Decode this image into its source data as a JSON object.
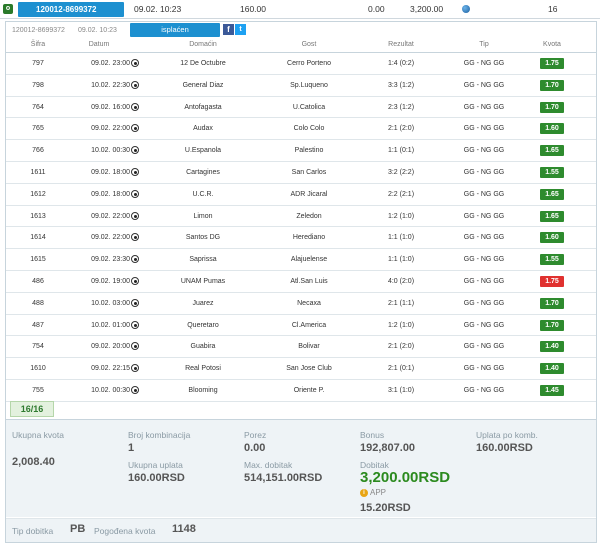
{
  "topbar": {
    "status_letter": "o",
    "ticket_id": "120012-8699372",
    "datetime": "09.02. 10:23",
    "stake": "160.00",
    "zero": "0.00",
    "payout": "3,200.00",
    "count": "16"
  },
  "subhead": {
    "ticket_id": "120012-8699372",
    "datetime": "09.02. 10:23",
    "status_label": "isplaćen",
    "fb": "f",
    "tw": "t"
  },
  "headers": {
    "sifra": "Šifra",
    "datum": "Datum",
    "domacin": "Domaćin",
    "gost": "Gost",
    "rezultat": "Rezultat",
    "tip": "Tip",
    "kvota": "Kvota"
  },
  "rows": [
    {
      "sifra": "797",
      "datum": "09.02. 23:00",
      "home": "12 De Octubre",
      "away": "Cerro Porteno",
      "rez": "1:4 (0:2)",
      "tip": "GG - NG GG",
      "kvota": "1.75",
      "status": "win"
    },
    {
      "sifra": "798",
      "datum": "10.02. 22:30",
      "home": "General Diaz",
      "away": "Sp.Luqueno",
      "rez": "3:3 (1:2)",
      "tip": "GG - NG GG",
      "kvota": "1.70",
      "status": "win"
    },
    {
      "sifra": "764",
      "datum": "09.02. 16:00",
      "home": "Antofagasta",
      "away": "U.Catolica",
      "rez": "2:3 (1:2)",
      "tip": "GG - NG GG",
      "kvota": "1.70",
      "status": "win"
    },
    {
      "sifra": "765",
      "datum": "09.02. 22:00",
      "home": "Audax",
      "away": "Colo Colo",
      "rez": "2:1 (2:0)",
      "tip": "GG - NG GG",
      "kvota": "1.60",
      "status": "win"
    },
    {
      "sifra": "766",
      "datum": "10.02. 00:30",
      "home": "U.Espanola",
      "away": "Palestino",
      "rez": "1:1 (0:1)",
      "tip": "GG - NG GG",
      "kvota": "1.65",
      "status": "win"
    },
    {
      "sifra": "1611",
      "datum": "09.02. 18:00",
      "home": "Cartagines",
      "away": "San Carlos",
      "rez": "3:2 (2:2)",
      "tip": "GG - NG GG",
      "kvota": "1.55",
      "status": "win"
    },
    {
      "sifra": "1612",
      "datum": "09.02. 18:00",
      "home": "U.C.R.",
      "away": "ADR Jicaral",
      "rez": "2:2 (2:1)",
      "tip": "GG - NG GG",
      "kvota": "1.65",
      "status": "win"
    },
    {
      "sifra": "1613",
      "datum": "09.02. 22:00",
      "home": "Limon",
      "away": "Zeledon",
      "rez": "1:2 (1:0)",
      "tip": "GG - NG GG",
      "kvota": "1.65",
      "status": "win"
    },
    {
      "sifra": "1614",
      "datum": "09.02. 22:00",
      "home": "Santos DG",
      "away": "Herediano",
      "rez": "1:1 (1:0)",
      "tip": "GG - NG GG",
      "kvota": "1.60",
      "status": "win"
    },
    {
      "sifra": "1615",
      "datum": "09.02. 23:30",
      "home": "Saprissa",
      "away": "Alajuelense",
      "rez": "1:1 (1:0)",
      "tip": "GG - NG GG",
      "kvota": "1.55",
      "status": "win"
    },
    {
      "sifra": "486",
      "datum": "09.02. 19:00",
      "home": "UNAM Pumas",
      "away": "Atl.San Luis",
      "rez": "4:0 (2:0)",
      "tip": "GG - NG GG",
      "kvota": "1.75",
      "status": "lose"
    },
    {
      "sifra": "488",
      "datum": "10.02. 03:00",
      "home": "Juarez",
      "away": "Necaxa",
      "rez": "2:1 (1:1)",
      "tip": "GG - NG GG",
      "kvota": "1.70",
      "status": "win"
    },
    {
      "sifra": "487",
      "datum": "10.02. 01:00",
      "home": "Queretaro",
      "away": "Cl.America",
      "rez": "1:2 (1:0)",
      "tip": "GG - NG GG",
      "kvota": "1.70",
      "status": "win"
    },
    {
      "sifra": "754",
      "datum": "09.02. 20:00",
      "home": "Guabira",
      "away": "Bolivar",
      "rez": "2:1 (2:0)",
      "tip": "GG - NG GG",
      "kvota": "1.40",
      "status": "win"
    },
    {
      "sifra": "1610",
      "datum": "09.02. 22:15",
      "home": "Real Potosi",
      "away": "San Jose Club",
      "rez": "2:1 (0:1)",
      "tip": "GG - NG GG",
      "kvota": "1.40",
      "status": "win"
    },
    {
      "sifra": "755",
      "datum": "10.02. 00:30",
      "home": "Blooming",
      "away": "Oriente P.",
      "rez": "3:1 (1:0)",
      "tip": "GG - NG GG",
      "kvota": "1.45",
      "status": "win"
    }
  ],
  "count_badge": "16/16",
  "summary": {
    "ukupna_kvota_label": "Ukupna kvota",
    "ukupna_kvota": "2,008.40",
    "broj_kombinacija_label": "Broj kombinacija",
    "broj_kombinacija": "1",
    "ukupna_uplata_label": "Ukupna uplata",
    "ukupna_uplata": "160.00RSD",
    "porez_label": "Porez",
    "porez": "0.00",
    "max_dobitak_label": "Max. dobitak",
    "max_dobitak": "514,151.00RSD",
    "bonus_label": "Bonus",
    "bonus": "192,807.00",
    "dobitak_label": "Dobitak",
    "dobitak": "3,200.00RSD",
    "app_label": "APP",
    "app_value": "15.20RSD",
    "uplata_po_komb_label": "Uplata po komb.",
    "uplata_po_komb": "160.00RSD"
  },
  "footer": {
    "tip_dobitka_label": "Tip dobitka",
    "tip_dobitka": "PB",
    "pogodjena_kvota_label": "Pogođena kvota",
    "pogodjena_kvota": "1148"
  },
  "colors": {
    "accent": "#1d90d0",
    "win": "#2e8b2e",
    "lose": "#e0312f"
  }
}
